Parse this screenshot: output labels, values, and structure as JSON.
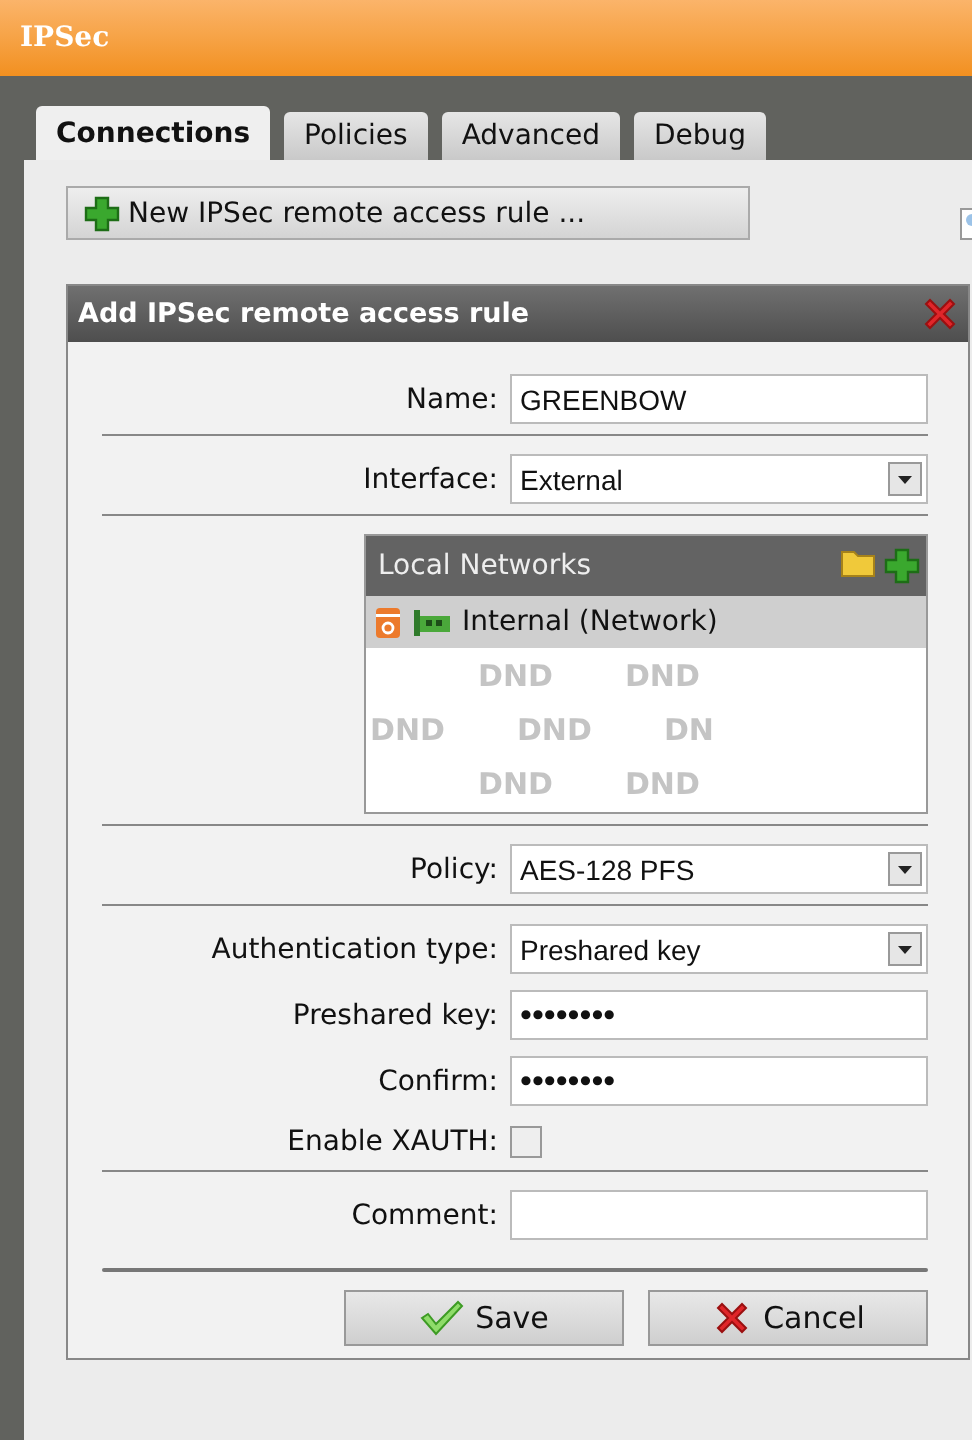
{
  "window": {
    "title": "IPSec"
  },
  "tabs": [
    {
      "label": "Connections",
      "selected": true
    },
    {
      "label": "Policies",
      "selected": false
    },
    {
      "label": "Advanced",
      "selected": false
    },
    {
      "label": "Debug",
      "selected": false
    }
  ],
  "new_button": {
    "label": "New IPSec remote access rule ..."
  },
  "dialog": {
    "title": "Add IPSec remote access rule",
    "rows": [
      {
        "kind": "text",
        "label": "Name:",
        "value": "GREENBOW",
        "divider_after": true
      },
      {
        "kind": "select",
        "label": "Interface:",
        "value": "External",
        "divider_after": true
      },
      {
        "kind": "networks",
        "title": "Local Networks",
        "items": [
          {
            "label": "Internal (Network)",
            "selected": true
          }
        ],
        "drop_marks": [
          [
            "DND",
            "DND"
          ],
          [
            "DND",
            "DND",
            "DN"
          ],
          [
            "DND",
            "DND"
          ]
        ],
        "divider_after": true
      },
      {
        "kind": "select",
        "label": "Policy:",
        "value": "AES-128 PFS",
        "divider_after": true
      },
      {
        "kind": "select",
        "label": "Authentication type:",
        "value": "Preshared key",
        "divider_after": false
      },
      {
        "kind": "text",
        "label": "Preshared key:",
        "value": "••••••••",
        "divider_after": false
      },
      {
        "kind": "text",
        "label": "Confirm:",
        "value": "••••••••",
        "divider_after": false
      },
      {
        "kind": "checkbox",
        "label": "Enable XAUTH:",
        "checked": false,
        "divider_after": true
      },
      {
        "kind": "text",
        "label": "Comment:",
        "value": "",
        "divider_after": false
      }
    ],
    "buttons": [
      {
        "kind": "save",
        "label": "Save"
      },
      {
        "kind": "cancel",
        "label": "Cancel"
      }
    ]
  }
}
